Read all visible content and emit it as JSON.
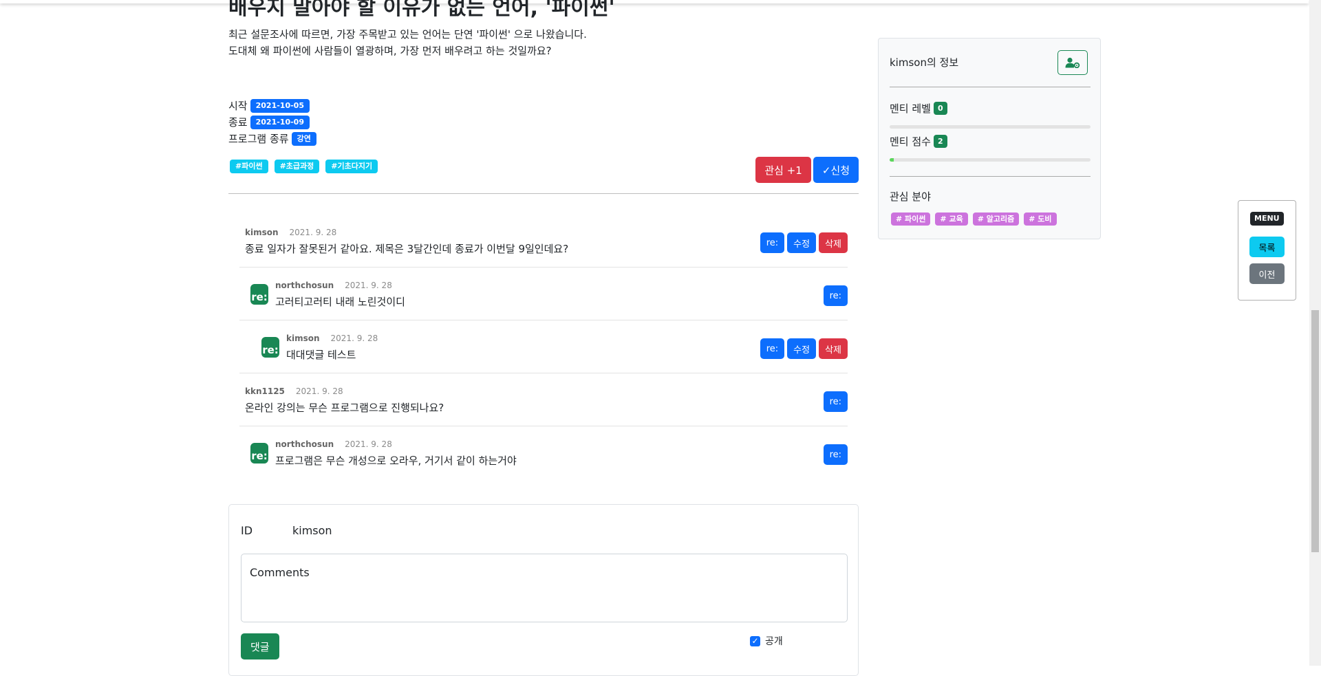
{
  "post": {
    "title": "배우지 말아야 할 이유가 없는 언어, '파이썬'",
    "desc_line1": "최근 설문조사에 따르면, 가장 주목받고 있는 언어는 단연 '파이썬' 으로 나왔습니다.",
    "desc_line2": "도대체 왜 파이썬에 사람들이 열광하며, 가장 먼저 배우려고 하는 것일까요?",
    "start_label": "시작",
    "start_date": "2021-10-05",
    "end_label": "종료",
    "end_date": "2021-10-09",
    "type_label": "프로그램 종류",
    "type_value": "강연",
    "tags": [
      "#파이썬",
      "#초급과정",
      "#기초다지기"
    ],
    "interest_button": "관심 +1",
    "apply_button": "✓신청"
  },
  "comments": [
    {
      "author": "kimson",
      "date": "2021. 9. 28",
      "text": "종료 일자가 잘못된거 같아요. 제목은 3달간인데 종료가 이번달 9일인데요?",
      "depth": 0,
      "buttons": [
        "re:",
        "수정",
        "삭제"
      ]
    },
    {
      "author": "northchosun",
      "date": "2021. 9. 28",
      "text": "고러티고러티 내래 노린것이디",
      "depth": 1,
      "buttons": [
        "re:"
      ]
    },
    {
      "author": "kimson",
      "date": "2021. 9. 28",
      "text": "대대댓글 테스트",
      "depth": 2,
      "buttons": [
        "re:",
        "수정",
        "삭제"
      ]
    },
    {
      "author": "kkn1125",
      "date": "2021. 9. 28",
      "text": "온라인 강의는 무슨 프로그램으로 진행되나요?",
      "depth": 0,
      "buttons": [
        "re:"
      ]
    },
    {
      "author": "northchosun",
      "date": "2021. 9. 28",
      "text": "프로그램은 무슨 개성으로 오라우, 거기서 같이 하는거야",
      "depth": 1,
      "buttons": [
        "re:"
      ]
    }
  ],
  "reply_icon_text": "re:",
  "comment_form": {
    "id_label": "ID",
    "id_value": "kimson",
    "placeholder": "Comments",
    "submit_label": "댓글",
    "public_label": "공개",
    "public_checked": true
  },
  "profile": {
    "title": "kimson의 정보",
    "settings_icon": "user-gear-icon",
    "level_label": "멘티 레벨",
    "level_value": "0",
    "level_progress": 0,
    "score_label": "멘티 점수",
    "score_value": "2",
    "score_progress": 0.02,
    "interest_label": "관심 분야",
    "interests": [
      "# 파이썬",
      "# 교육",
      "# 알고리즘",
      "# 도비"
    ]
  },
  "menu": {
    "label": "MENU",
    "list_button": "목록",
    "prev_button": "이전"
  },
  "colors": {
    "primary": "#0d6efd",
    "danger": "#dc3545",
    "success": "#198754",
    "info": "#0dcaf0",
    "interest_tag": "#cc73dd"
  }
}
